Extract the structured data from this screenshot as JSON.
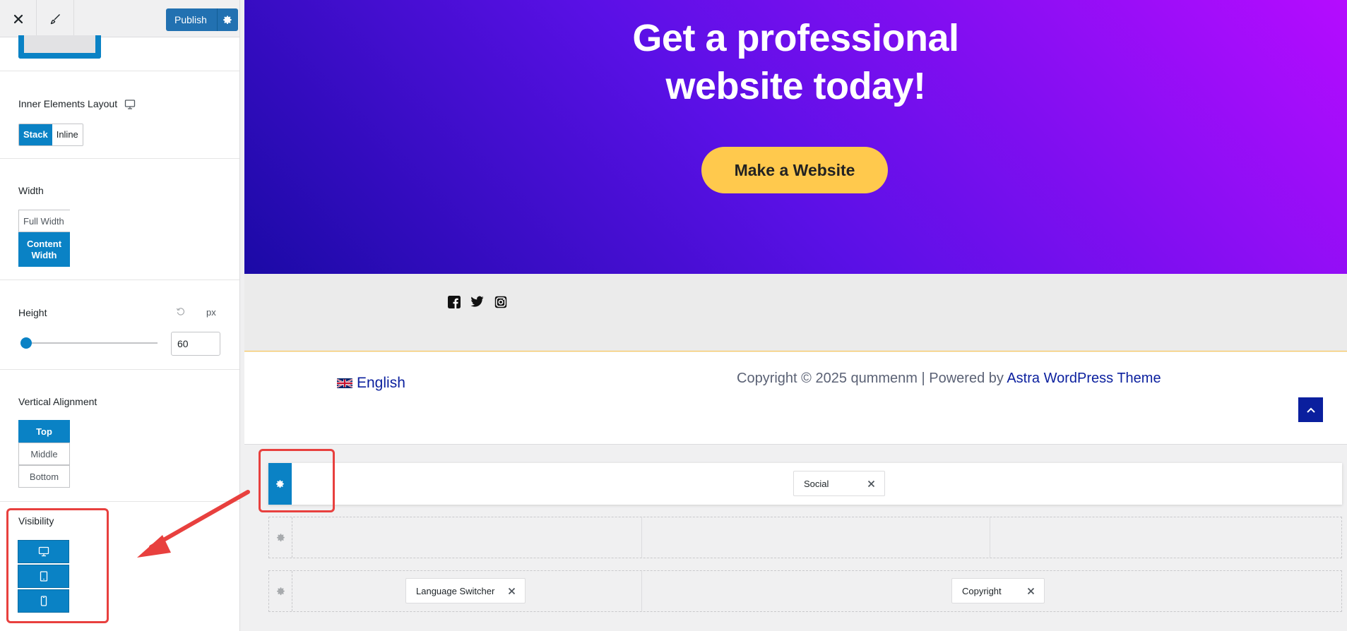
{
  "toolbar": {
    "close_icon": "close-icon",
    "design_icon": "brush-icon",
    "publish_label": "Publish",
    "settings_icon": "gear-icon"
  },
  "sidebar": {
    "inner_layout": {
      "label": "Inner Elements Layout",
      "device_icon": "desktop-icon",
      "options": [
        "Stack",
        "Inline"
      ],
      "selected": "Stack"
    },
    "width": {
      "label": "Width",
      "options": [
        "Full Width",
        "Content Width"
      ],
      "selected": "Content Width"
    },
    "height": {
      "label": "Height",
      "unit": "px",
      "value": "60",
      "slider_level": 0.05
    },
    "vertical_alignment": {
      "label": "Vertical Alignment",
      "options": [
        "Top",
        "Middle",
        "Bottom"
      ],
      "selected": "Top"
    },
    "visibility": {
      "label": "Visibility",
      "devices": [
        "desktop-icon",
        "tablet-icon",
        "mobile-icon"
      ]
    }
  },
  "preview": {
    "hero": {
      "title_line1": "Get a professional",
      "title_line2": "website today!",
      "cta_label": "Make a Website"
    },
    "social_icons": [
      "facebook-icon",
      "twitter-icon",
      "instagram-icon"
    ],
    "footer": {
      "language": "English",
      "copyright_text": "Copyright © 2025 qummenm | Powered by ",
      "copyright_link": "Astra WordPress Theme"
    },
    "builder": {
      "row1_items": [
        "Social"
      ],
      "row3_left": "Language Switcher",
      "row3_right": "Copyright"
    }
  },
  "colors": {
    "accent": "#0a82c5",
    "publish": "#2271b1",
    "cta": "#ffc94d",
    "annotation": "#e8403e"
  }
}
